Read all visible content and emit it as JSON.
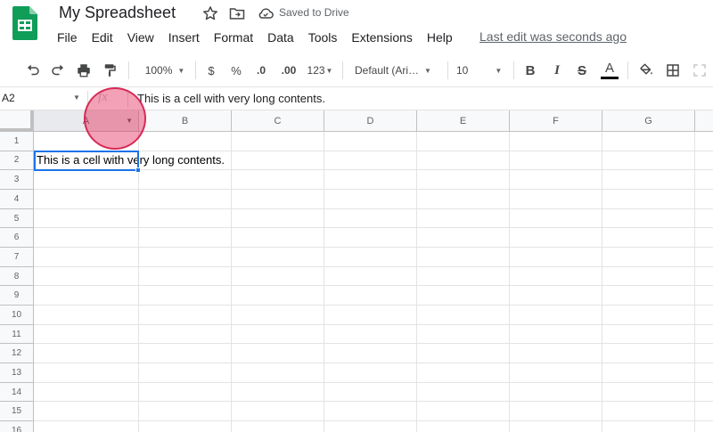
{
  "header": {
    "title": "My Spreadsheet",
    "saved_status": "Saved to Drive",
    "last_edit": "Last edit was seconds ago",
    "icons": [
      "sheets-logo",
      "star-icon",
      "move-to-folder-icon",
      "cloud-saved-icon"
    ]
  },
  "menu": {
    "items": [
      "File",
      "Edit",
      "View",
      "Insert",
      "Format",
      "Data",
      "Tools",
      "Extensions",
      "Help"
    ]
  },
  "toolbar": {
    "zoom": "100%",
    "currency": "$",
    "percent": "%",
    "decrease_decimals": ".0",
    "increase_decimals": ".00",
    "more_formats": "123",
    "font_family": "Default (Ari…",
    "font_size": "10",
    "bold": "B",
    "italic": "I",
    "strikethrough": "S",
    "text_color": "A"
  },
  "formula_bar": {
    "name_box": "A2",
    "fx": "fx",
    "content": "This is a cell with very long contents."
  },
  "sheet": {
    "columns": [
      "A",
      "B",
      "C",
      "D",
      "E",
      "F",
      "G"
    ],
    "rows": [
      "1",
      "2",
      "3",
      "4",
      "5",
      "6",
      "7",
      "8",
      "9",
      "10",
      "11",
      "12",
      "13",
      "14",
      "15",
      "16"
    ],
    "selected_cell": "A2",
    "cell_a2": "This is a cell with very long contents."
  },
  "colors": {
    "selection": "#1a73e8",
    "sheets_green": "#0f9d58",
    "click_indicator": "#e22052"
  }
}
